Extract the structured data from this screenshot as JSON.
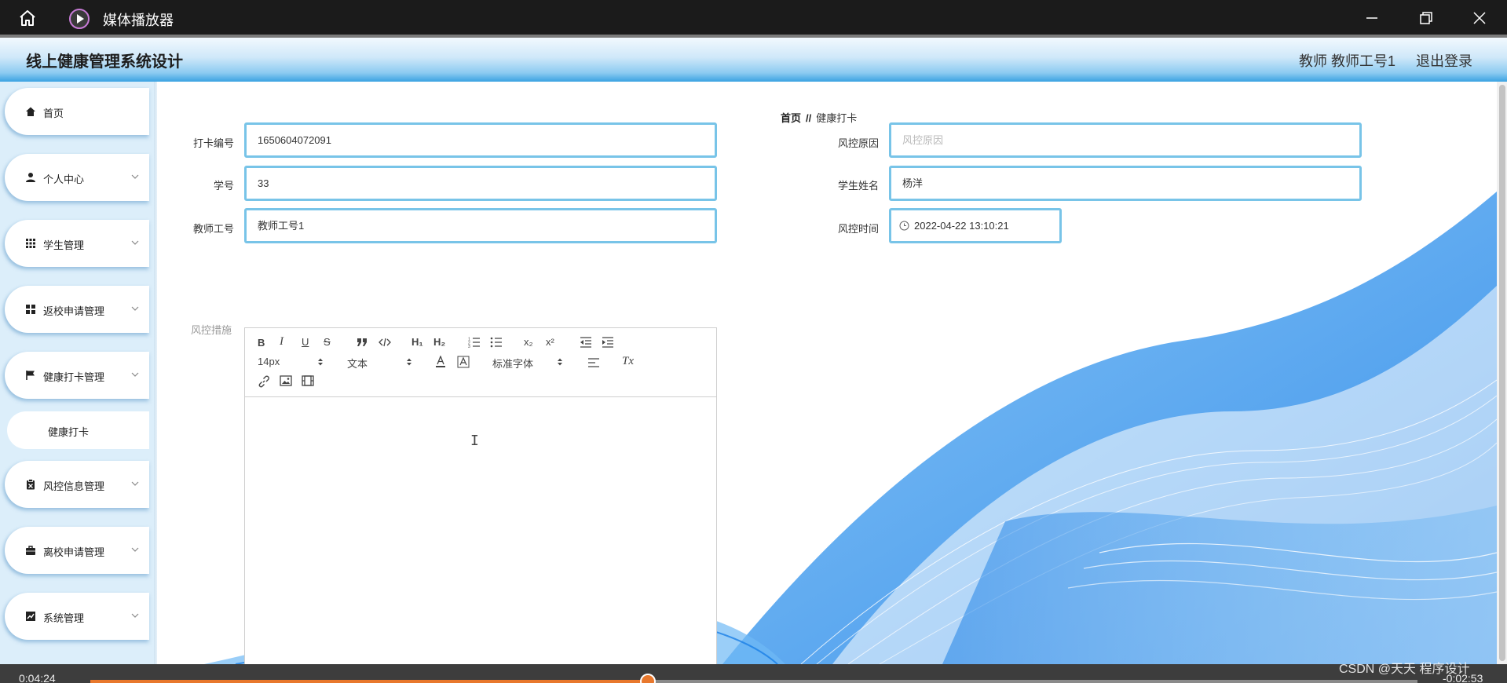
{
  "player": {
    "title": "媒体播放器",
    "time_elapsed": "0:04:24",
    "time_remaining": "-0:02:53",
    "progress_fraction": 0.42,
    "watermark": "CSDN @天天 程序设计",
    "accent": "#e8782d"
  },
  "header": {
    "app_title": "线上健康管理系统设计",
    "user_info": "教师 教师工号1",
    "logout": "退出登录"
  },
  "sidebar": {
    "items": [
      {
        "label": "首页",
        "icon": "home-icon"
      },
      {
        "label": "个人中心",
        "icon": "person-icon"
      },
      {
        "label": "学生管理",
        "icon": "grid-icon"
      },
      {
        "label": "返校申请管理",
        "icon": "apps-icon"
      },
      {
        "label": "健康打卡管理",
        "icon": "flag-icon"
      },
      {
        "label": "风控信息管理",
        "icon": "clipboard-icon"
      },
      {
        "label": "离校申请管理",
        "icon": "briefcase-icon"
      },
      {
        "label": "系统管理",
        "icon": "chart-icon"
      }
    ],
    "subitem": {
      "label": "健康打卡"
    }
  },
  "breadcrumb": {
    "home": "首页",
    "separator": "//",
    "current": "健康打卡"
  },
  "form": {
    "checkin_no": {
      "label": "打卡编号",
      "value": "1650604072091"
    },
    "student_id": {
      "label": "学号",
      "value": "33"
    },
    "teacher_id": {
      "label": "教师工号",
      "value": "教师工号1"
    },
    "risk_reason": {
      "label": "风控原因",
      "placeholder": "风控原因"
    },
    "student_name": {
      "label": "学生姓名",
      "value": "杨洋"
    },
    "risk_time": {
      "label": "风控时间",
      "value": "2022-04-22 13:10:21"
    },
    "measures": {
      "label": "风控措施"
    }
  },
  "editor": {
    "bold": "B",
    "italic": "I",
    "underline": "U",
    "strike": "S",
    "h1": "H₁",
    "h2": "H₂",
    "sub": "x₂",
    "sup": "x²",
    "size": "14px",
    "header_picker": "文本",
    "font_picker": "标准字体",
    "clean": "Tx",
    "cursor": "I"
  },
  "colors": {
    "header_gradient_end": "#3aa2e2",
    "sidebar_bg": "#dceefa",
    "input_border": "#78c4e8",
    "wave_blue": "#1a7fe6"
  }
}
